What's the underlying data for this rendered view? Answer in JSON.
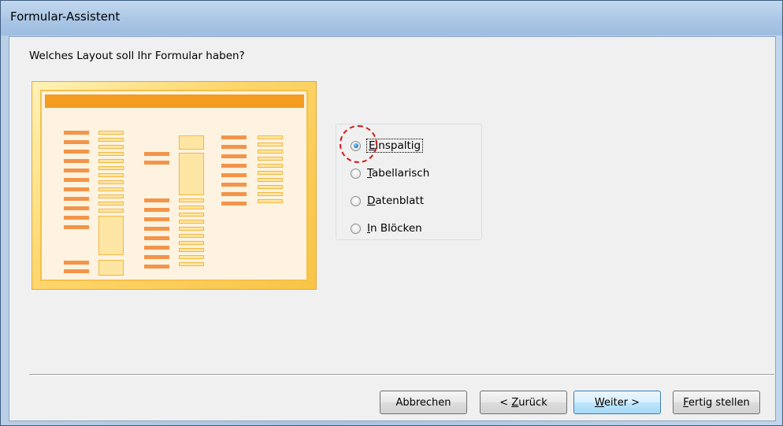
{
  "window": {
    "title": "Formular-Assistent"
  },
  "question": "Welches Layout soll Ihr Formular haben?",
  "options": [
    {
      "pre": "",
      "accel": "E",
      "post": "inspaltig",
      "checked": true,
      "focused": true
    },
    {
      "pre": "",
      "accel": "T",
      "post": "abellarisch",
      "checked": false,
      "focused": false
    },
    {
      "pre": "",
      "accel": "D",
      "post": "atenblatt",
      "checked": false,
      "focused": false
    },
    {
      "pre": "",
      "accel": "I",
      "post": "n Blöcken",
      "checked": false,
      "focused": false
    }
  ],
  "buttons": {
    "cancel": "Abbrechen",
    "back_pre": "< ",
    "back_accel": "Z",
    "back_post": "urück",
    "next_accel": "W",
    "next_post": "eiter >",
    "finish_accel": "F",
    "finish_post": "ertig stellen"
  },
  "colors": {
    "preview_header": "#f39c1f",
    "preview_bar": "#f2944a",
    "highlight": "#d21a1a"
  }
}
